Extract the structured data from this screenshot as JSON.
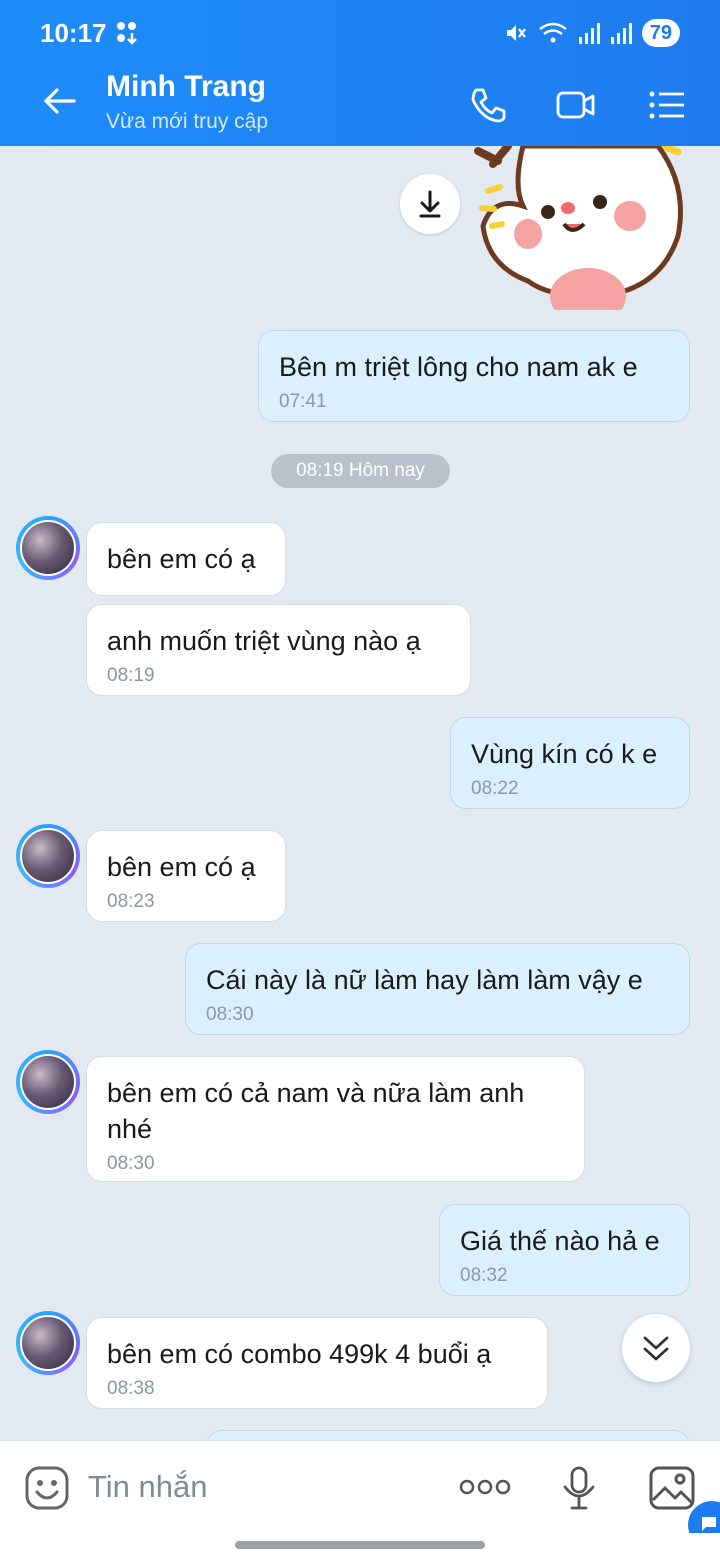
{
  "status_bar": {
    "time": "10:17",
    "battery": "79"
  },
  "header": {
    "title": "Minh Trang",
    "subtitle": "Vừa mới truy cập"
  },
  "date_separator": "08:19 Hôm nay",
  "messages": [
    {
      "side": "out",
      "text": "Bên m triệt lông cho nam ak e",
      "time": "07:41"
    },
    {
      "side": "in",
      "text": "bên em có ạ",
      "time": ""
    },
    {
      "side": "in",
      "text": "anh muốn triệt vùng nào ạ",
      "time": "08:19"
    },
    {
      "side": "out",
      "text": "Vùng kín có k e",
      "time": "08:22"
    },
    {
      "side": "in",
      "text": "bên em có ạ",
      "time": "08:23"
    },
    {
      "side": "out",
      "text": "Cái này là nữ làm hay làm làm vậy e",
      "time": "08:30"
    },
    {
      "side": "in",
      "text": "bên em có cả nam và nữa làm anh nhé",
      "time": "08:30"
    },
    {
      "side": "out",
      "text": "Giá thế nào hả e",
      "time": "08:32"
    },
    {
      "side": "in",
      "text": "bên em có combo 499k 4 buổi ạ",
      "time": "08:38"
    }
  ],
  "input": {
    "placeholder": "Tin nhắn"
  },
  "icons": {
    "back": "arrow-left-icon",
    "call": "phone-icon",
    "video": "video-icon",
    "menu": "list-menu-icon",
    "sticker": "sticker-icon",
    "more": "more-dots-icon",
    "voice": "mic-icon",
    "image": "image-icon",
    "download": "download-icon",
    "scroll": "double-chevron-down-icon"
  },
  "colors": {
    "header": "#1f7cf0",
    "out_bubble": "#dbf0fd",
    "in_bubble": "#ffffff",
    "background": "#e2e9f1"
  }
}
